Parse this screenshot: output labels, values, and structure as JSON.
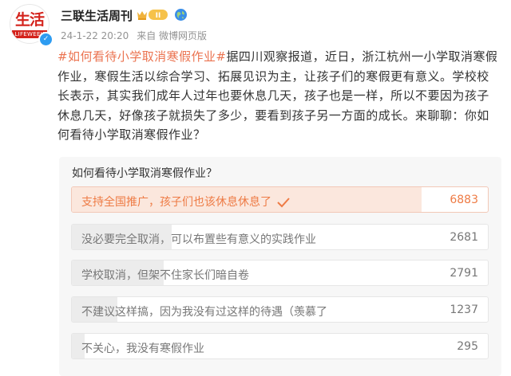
{
  "author": {
    "avatar_logo_text": "生活",
    "avatar_logo_sub": "LIFEWEEK",
    "name": "三联生活周刊",
    "badge_label": "II",
    "post_time": "24-1-22 20:20",
    "source": "来自 微博网页版"
  },
  "post": {
    "hashtag": "#如何看待小学取消寒假作业#",
    "body": "据四川观察报道，近日，浙江杭州一小学取消寒假作业，寒假生活以综合学习、拓展见识为主，让孩子们的寒假更有意义。学校校长表示，其实我们成年人过年也要休息几天，孩子也是一样，所以不要因为孩子休息几天，好像孩子就损失了多少，要看到孩子另一方面的成长。来聊聊：你如何看待小学取消寒假作业？"
  },
  "poll": {
    "title": "如何看待小学取消寒假作业？",
    "options": [
      {
        "label": "支持全国推广，孩子们也该休息休息了",
        "count": "6883",
        "share": 0.84,
        "selected": true
      },
      {
        "label": "没必要完全取消，可以布置些有意义的实践作业",
        "count": "2681",
        "share": 0.24,
        "selected": false
      },
      {
        "label": "学校取消，但架不住家长们暗自卷",
        "count": "2791",
        "share": 0.22,
        "selected": false
      },
      {
        "label": "不建议这样搞，因为我没有过这样的待遇（羡慕了",
        "count": "1237",
        "share": 0.11,
        "selected": false
      },
      {
        "label": "不关心，我没有寒假作业",
        "count": "295",
        "share": 0.03,
        "selected": false
      }
    ]
  },
  "colors": {
    "accent": "#eb7350",
    "verified": "#2d9cf1",
    "brand_red": "#d4231c"
  }
}
